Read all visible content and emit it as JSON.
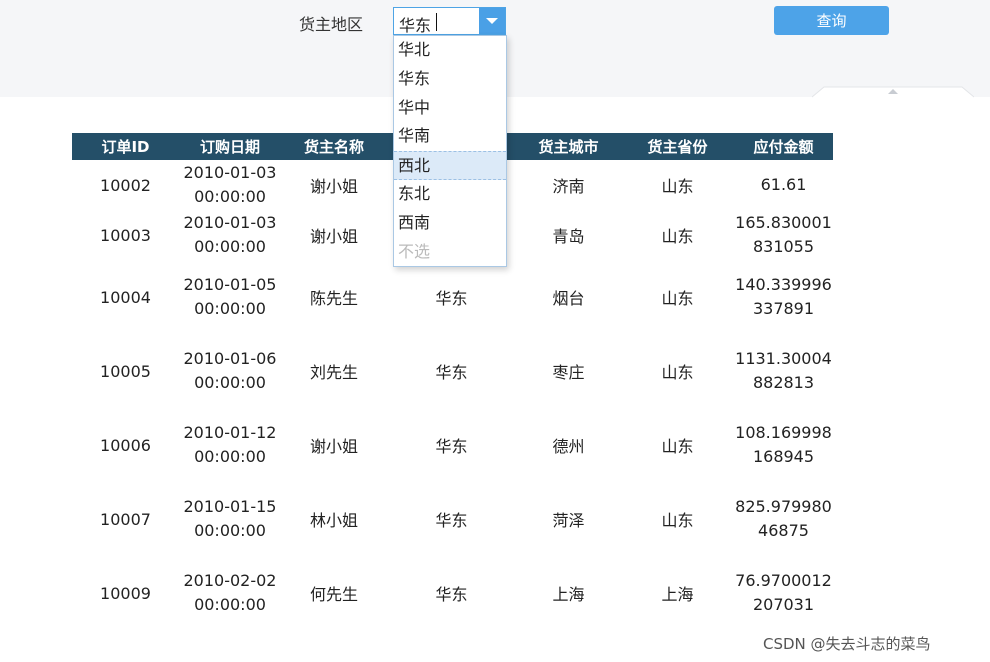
{
  "params": {
    "label": "货主地区",
    "combo_value": "华东",
    "query_label": "查询"
  },
  "dropdown": {
    "options": [
      "华北",
      "华东",
      "华中",
      "华南",
      "西北",
      "东北",
      "西南",
      "不选"
    ],
    "highlighted": "西北"
  },
  "table": {
    "headers": [
      "订单ID",
      "订购日期",
      "货主名称",
      "",
      "货主城市",
      "货主省份",
      "应付金额"
    ],
    "rows": [
      {
        "id": "10002",
        "date": "2010-01-03",
        "time": "00:00:00",
        "name": "谢小姐",
        "region": "",
        "city": "济南",
        "province": "山东",
        "amount1": "61.61",
        "amount2": ""
      },
      {
        "id": "10003",
        "date": "2010-01-03",
        "time": "00:00:00",
        "name": "谢小姐",
        "region": "",
        "city": "青岛",
        "province": "山东",
        "amount1": "165.830001",
        "amount2": "831055"
      },
      {
        "id": "10004",
        "date": "2010-01-05",
        "time": "00:00:00",
        "name": "陈先生",
        "region": "华东",
        "city": "烟台",
        "province": "山东",
        "amount1": "140.339996",
        "amount2": "337891"
      },
      {
        "id": "10005",
        "date": "2010-01-06",
        "time": "00:00:00",
        "name": "刘先生",
        "region": "华东",
        "city": "枣庄",
        "province": "山东",
        "amount1": "1131.30004",
        "amount2": "882813"
      },
      {
        "id": "10006",
        "date": "2010-01-12",
        "time": "00:00:00",
        "name": "谢小姐",
        "region": "华东",
        "city": "德州",
        "province": "山东",
        "amount1": "108.169998",
        "amount2": "168945"
      },
      {
        "id": "10007",
        "date": "2010-01-15",
        "time": "00:00:00",
        "name": "林小姐",
        "region": "华东",
        "city": "菏泽",
        "province": "山东",
        "amount1": "825.979980",
        "amount2": "46875"
      },
      {
        "id": "10009",
        "date": "2010-02-02",
        "time": "00:00:00",
        "name": "何先生",
        "region": "华东",
        "city": "上海",
        "province": "上海",
        "amount1": "76.9700012",
        "amount2": "207031"
      }
    ]
  },
  "watermark": "CSDN @失去斗志的菜鸟",
  "colors": {
    "header_bg": "#244f68",
    "accent": "#4da3e8",
    "panel_bg": "#f5f6f8"
  }
}
